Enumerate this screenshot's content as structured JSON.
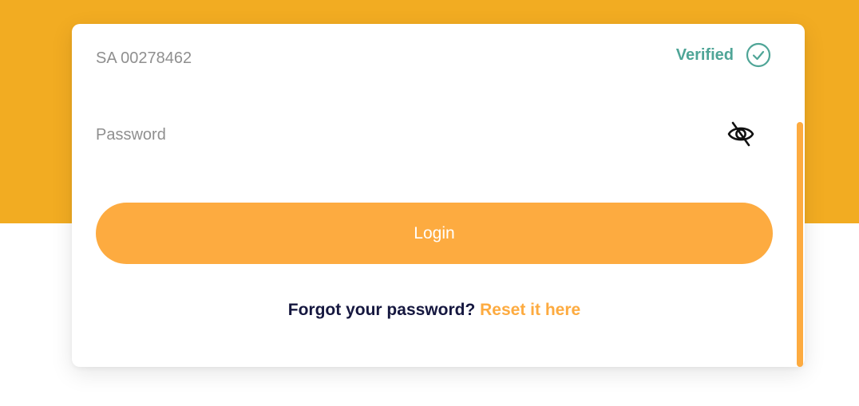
{
  "colors": {
    "header_band": "#F2AC22",
    "accent": "#FDAB40",
    "verified": "#4FA597",
    "text_dark": "#15173F",
    "text_muted": "#8f8f8f"
  },
  "account": {
    "number": "SA 00278462",
    "status": "Verified",
    "status_icon": "check-circle-icon"
  },
  "password": {
    "placeholder": "Password",
    "value": "",
    "toggle_icon": "eye-off-icon"
  },
  "login": {
    "label": "Login"
  },
  "forgot": {
    "text": "Forgot your password?",
    "link": "Reset it here"
  }
}
